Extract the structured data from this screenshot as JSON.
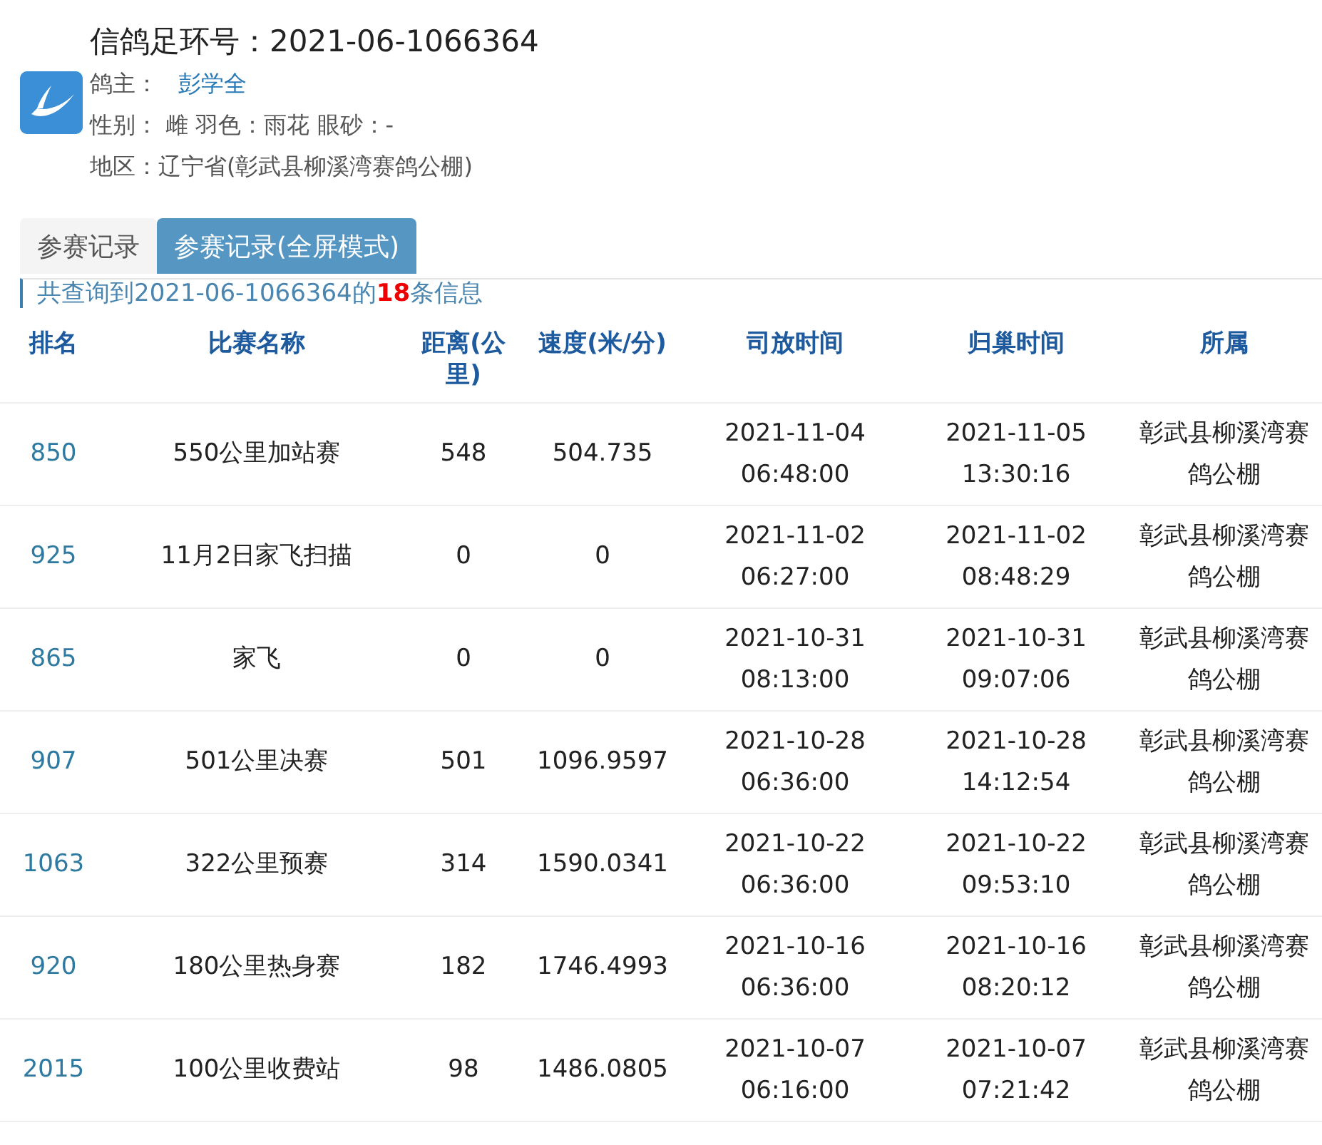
{
  "header": {
    "title": "信鸽足环号：2021-06-1066364",
    "owner_label": "鸽主：",
    "owner": "彭学全",
    "attributes": "性别： 雌 羽色：雨花 眼砂：-",
    "region": "地区：辽宁省(彰武县柳溪湾赛鸽公棚)"
  },
  "tabs": [
    {
      "label": "参赛记录",
      "selected": false
    },
    {
      "label": "参赛记录(全屏模式)",
      "selected": true
    }
  ],
  "summary": "共查询到2021-06-1066364的**18**条信息",
  "table": {
    "columns": [
      "排名",
      "比赛名称",
      "距离(公里)",
      "速度(米/分)",
      "司放时间",
      "归巢时间",
      "所属"
    ],
    "rows": [
      {
        "rank": "850",
        "race": "550公里加站赛",
        "distance": "548",
        "speed": "504.735",
        "release": "2021-11-04 06:48:00",
        "return": "2021-11-05 13:30:16",
        "loft": "彰武县柳溪湾赛鸽公棚"
      },
      {
        "rank": "925",
        "race": "11月2日家飞扫描",
        "distance": "0",
        "speed": "0",
        "release": "2021-11-02 06:27:00",
        "return": "2021-11-02 08:48:29",
        "loft": "彰武县柳溪湾赛鸽公棚"
      },
      {
        "rank": "865",
        "race": "家飞",
        "distance": "0",
        "speed": "0",
        "release": "2021-10-31 08:13:00",
        "return": "2021-10-31 09:07:06",
        "loft": "彰武县柳溪湾赛鸽公棚"
      },
      {
        "rank": "907",
        "race": "501公里决赛",
        "distance": "501",
        "speed": "1096.9597",
        "release": "2021-10-28 06:36:00",
        "return": "2021-10-28 14:12:54",
        "loft": "彰武县柳溪湾赛鸽公棚"
      },
      {
        "rank": "1063",
        "race": "322公里预赛",
        "distance": "314",
        "speed": "1590.0341",
        "release": "2021-10-22 06:36:00",
        "return": "2021-10-22 09:53:10",
        "loft": "彰武县柳溪湾赛鸽公棚"
      },
      {
        "rank": "920",
        "race": "180公里热身赛",
        "distance": "182",
        "speed": "1746.4993",
        "release": "2021-10-16 06:36:00",
        "return": "2021-10-16 08:20:12",
        "loft": "彰武县柳溪湾赛鸽公棚"
      },
      {
        "rank": "2015",
        "race": "100公里收费站",
        "distance": "98",
        "speed": "1486.0805",
        "release": "2021-10-07 06:16:00",
        "return": "2021-10-07 07:21:42",
        "loft": "彰武县柳溪湾赛鸽公棚"
      }
    ]
  }
}
